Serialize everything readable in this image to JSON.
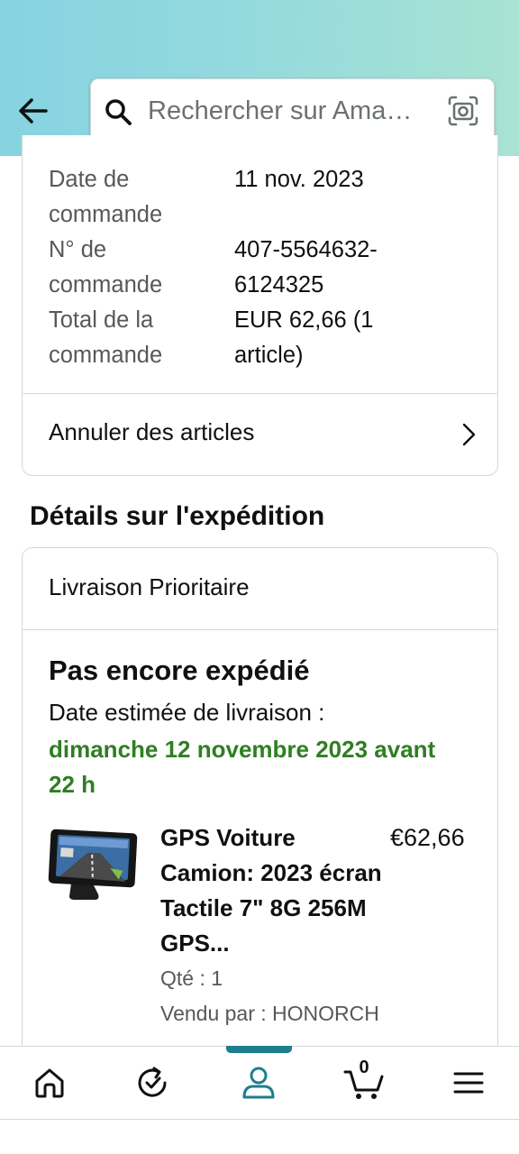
{
  "header": {
    "search_placeholder": "Rechercher sur Ama…"
  },
  "order_summary": {
    "rows": [
      {
        "label": "Date de commande",
        "value": "11 nov. 2023"
      },
      {
        "label": "N° de commande",
        "value": "407-5564632-6124325"
      },
      {
        "label": "Total de la commande",
        "value": "EUR 62,66 (1 article)"
      }
    ],
    "cancel_label": "Annuler des articles"
  },
  "shipment": {
    "section_title": "Détails sur l'expédition",
    "method": "Livraison Prioritaire",
    "status": "Pas encore expédié",
    "estimate_label": "Date estimée de livraison :",
    "estimate_date": "dimanche 12 novembre 2023 avant 22 h",
    "product": {
      "title": "GPS Voiture Camion: 2023 écran Tactile 7\" 8G 256M GPS...",
      "price": "€62,66",
      "qty": "Qté : 1",
      "seller": "Vendu par : HONORCH"
    }
  },
  "bottom_nav": {
    "cart_count": "0",
    "items": [
      "home-icon",
      "reorder-icon",
      "account-icon",
      "cart-icon",
      "menu-icon"
    ]
  },
  "colors": {
    "accent": "#1d7e8c",
    "delivery_green": "#2f7e23"
  }
}
